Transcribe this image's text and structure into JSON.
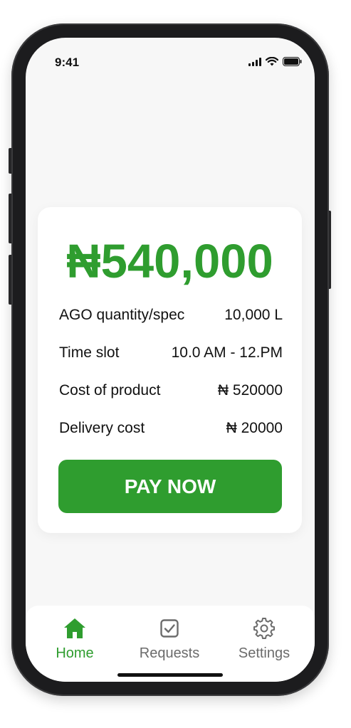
{
  "status_bar": {
    "time": "9:41",
    "icons": [
      "signal-icon",
      "wifi-icon",
      "battery-icon"
    ]
  },
  "payment": {
    "amount": "₦540,000",
    "details": [
      {
        "label": "AGO quantity/spec",
        "value": "10,000 L"
      },
      {
        "label": "Time slot",
        "value": "10.0 AM - 12.PM"
      },
      {
        "label": "Cost of product",
        "value": "₦ 520000"
      },
      {
        "label": "Delivery cost",
        "value": "₦ 20000"
      }
    ],
    "pay_button_label": "PAY NOW"
  },
  "tab_bar": {
    "active": "Home",
    "tabs": [
      {
        "label": "Home",
        "icon": "home-icon"
      },
      {
        "label": "Requests",
        "icon": "checkbox-icon"
      },
      {
        "label": "Settings",
        "icon": "gear-icon"
      }
    ]
  },
  "colors": {
    "accent": "#2f9d2f",
    "inactive": "#6b6b6b",
    "screen_background": "#f7f7f7",
    "card_background": "#ffffff"
  }
}
